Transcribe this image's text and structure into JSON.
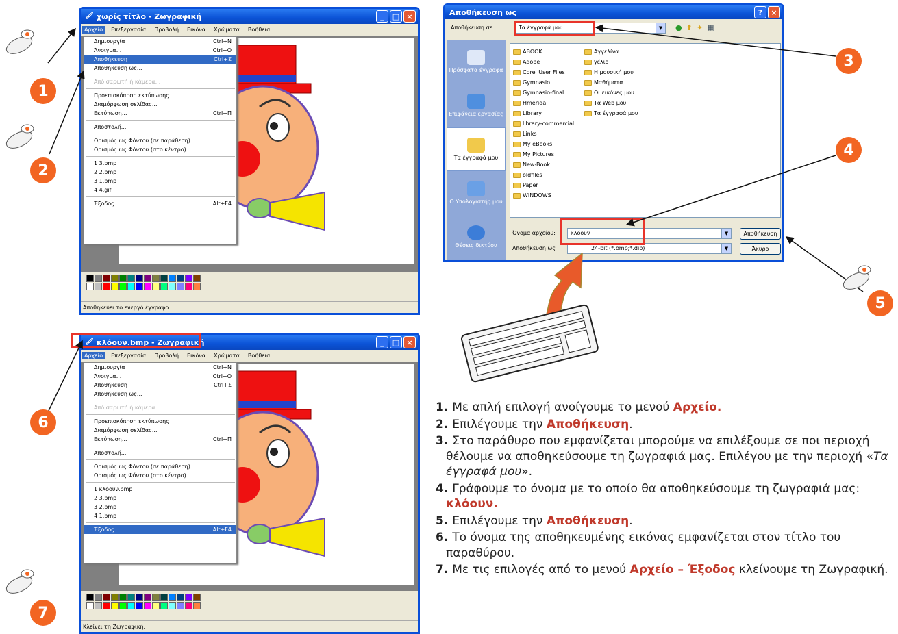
{
  "window1": {
    "title": "χωρίς τίτλο - Ζωγραφική",
    "menu": [
      "Αρχείο",
      "Επεξεργασία",
      "Προβολή",
      "Εικόνα",
      "Χρώματα",
      "Βοήθεια"
    ],
    "items": [
      {
        "label": "Δημιουργία",
        "sc": "Ctrl+N"
      },
      {
        "label": "Άνοιγμα...",
        "sc": "Ctrl+O"
      },
      {
        "label": "Αποθήκευση",
        "sc": "Ctrl+Σ"
      },
      {
        "label": "Αποθήκευση ως...",
        "sc": ""
      },
      {
        "label": "Από σαρωτή ή κάμερα...",
        "sc": ""
      },
      {
        "label": "Προεπισκόπηση εκτύπωσης",
        "sc": ""
      },
      {
        "label": "Διαμόρφωση σελίδας...",
        "sc": ""
      },
      {
        "label": "Εκτύπωση...",
        "sc": "Ctrl+Π"
      },
      {
        "label": "Αποστολή...",
        "sc": ""
      },
      {
        "label": "Ορισμός ως Φόντου (σε παράθεση)",
        "sc": ""
      },
      {
        "label": "Ορισμός ως Φόντου (στο κέντρο)",
        "sc": ""
      },
      {
        "label": "1 3.bmp",
        "sc": ""
      },
      {
        "label": "2 2.bmp",
        "sc": ""
      },
      {
        "label": "3 1.bmp",
        "sc": ""
      },
      {
        "label": "4 4.gif",
        "sc": ""
      },
      {
        "label": "Έξοδος",
        "sc": "Alt+F4"
      }
    ],
    "status": "Αποθηκεύει το ενεργό έγγραφο."
  },
  "window2": {
    "title": "κλόουν.bmp - Ζωγραφική",
    "menu": [
      "Αρχείο",
      "Επεξεργασία",
      "Προβολή",
      "Εικόνα",
      "Χρώματα",
      "Βοήθεια"
    ],
    "items": [
      {
        "label": "Δημιουργία",
        "sc": "Ctrl+N"
      },
      {
        "label": "Άνοιγμα...",
        "sc": "Ctrl+O"
      },
      {
        "label": "Αποθήκευση",
        "sc": "Ctrl+Σ"
      },
      {
        "label": "Αποθήκευση ως...",
        "sc": ""
      },
      {
        "label": "Από σαρωτή ή κάμερα...",
        "sc": ""
      },
      {
        "label": "Προεπισκόπηση εκτύπωσης",
        "sc": ""
      },
      {
        "label": "Διαμόρφωση σελίδας...",
        "sc": ""
      },
      {
        "label": "Εκτύπωση...",
        "sc": "Ctrl+Π"
      },
      {
        "label": "Αποστολή...",
        "sc": ""
      },
      {
        "label": "Ορισμός ως Φόντου (σε παράθεση)",
        "sc": ""
      },
      {
        "label": "Ορισμός ως Φόντου (στο κέντρο)",
        "sc": ""
      },
      {
        "label": "1 κλόουν.bmp",
        "sc": ""
      },
      {
        "label": "2 3.bmp",
        "sc": ""
      },
      {
        "label": "3 2.bmp",
        "sc": ""
      },
      {
        "label": "4 1.bmp",
        "sc": ""
      },
      {
        "label": "Έξοδος",
        "sc": "Alt+F4"
      }
    ],
    "status": "Κλείνει τη Ζωγραφική."
  },
  "dialog": {
    "title": "Αποθήκευση ως",
    "save_in_label": "Αποθήκευση σε:",
    "save_in_value": "Τα έγγραφά μου",
    "places": [
      "Πρόσφατα έγγραφα",
      "Επιφάνεια εργασίας",
      "Τα έγγραφά μου",
      "Ο Υπολογιστής μου",
      "Θέσεις δικτύου"
    ],
    "col1": [
      "ABOOK",
      "Adobe",
      "Corel User Files",
      "Gymnasio",
      "Gymnasio-final",
      "Hmerida",
      "Library",
      "library-commercial",
      "Links",
      "My eBooks",
      "My Pictures",
      "New-Book",
      "oldfiles",
      "Paper",
      "WINDOWS"
    ],
    "col2": [
      "Αγγελίνα",
      "γέλιο",
      "Η μουσική μου",
      "Μαθήματα",
      "Οι εικόνες μου",
      "Τα Web μου",
      "Τα έγγραφά μου"
    ],
    "filename_label": "Όνομα αρχείου:",
    "filename_value": "κλόουν",
    "type_label": "Αποθήκευση ως",
    "type_value": "24-bit (*.bmp;*.dib)",
    "save_button": "Αποθήκευση",
    "cancel_button": "Άκυρο"
  },
  "badges": [
    "1",
    "2",
    "3",
    "4",
    "5",
    "6",
    "7"
  ],
  "steps": [
    {
      "n": "1",
      "pre": "Με απλή επιλογή ανοίγουμε το μενού ",
      "kw": "Αρχείο.",
      "post": ""
    },
    {
      "n": "2",
      "pre": "Επιλέγουμε την ",
      "kw": "Αποθήκευση",
      "post": "."
    },
    {
      "n": "3",
      "pre": "Στο παράθυρο που εμφανίζεται μπορούμε να επιλέξουμε σε ποι περιοχή θέλουμε να αποθηκεύσουμε τη ζωγραφιά μας. Επιλέγου με την περιοχή «",
      "kw": "",
      "em": "Τα έγγραφά μου",
      "post": "»."
    },
    {
      "n": "4",
      "pre": "Γράφουμε το όνομα με το οποίο θα αποθηκεύσουμε τη ζωγραφιά μας: ",
      "kw": "κλόουν.",
      "post": ""
    },
    {
      "n": "5",
      "pre": "Επιλέγουμε την ",
      "kw": "Αποθήκευση",
      "post": "."
    },
    {
      "n": "6",
      "pre": "Το όνομα της αποθηκευμένης εικόνας εμφανίζεται στον τίτλο του παραθύρου.",
      "kw": "",
      "post": ""
    },
    {
      "n": "7",
      "pre": "Με τις επιλογές από το μενού ",
      "kw": "Αρχείο – Έξοδος",
      "post": " κλείνουμε τη Ζωγραφική."
    }
  ],
  "colors": {
    "accent": "#f26522",
    "highlight": "#e8342a",
    "xp_blue": "#0a4fd8"
  }
}
